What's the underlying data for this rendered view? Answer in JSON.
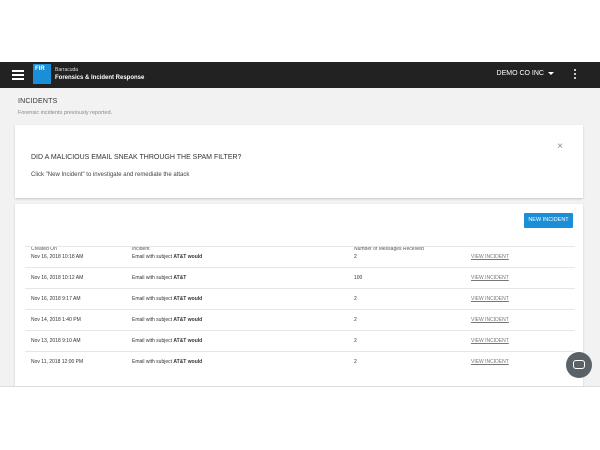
{
  "app": {
    "logo_text": "FIR",
    "brand_line1": "Barracuda",
    "brand_line2": "Forensics & Incident Response",
    "account": "DEMO CO INC"
  },
  "page": {
    "title": "INCIDENTS",
    "subtitle": "Forensic incidents previously reported."
  },
  "banner": {
    "heading": "DID A MALICIOUS EMAIL SNEAK THROUGH THE SPAM FILTER?",
    "message": "Click \"New Incident\" to investigate and remediate the attack",
    "close": "×"
  },
  "table": {
    "new_button": "NEW INCIDENT",
    "headers": {
      "created": "Created On",
      "incident": "Incident",
      "messages": "Number of Messages Received"
    },
    "subject_prefix": "Email with subject",
    "view_label": "VIEW INCIDENT",
    "rows": [
      {
        "created": "Nov 16, 2018 10:18 AM",
        "subject": "AT&T would",
        "count": "2"
      },
      {
        "created": "Nov 16, 2018 10:12 AM",
        "subject": "AT&T",
        "count": "100"
      },
      {
        "created": "Nov 16, 2018 9:17 AM",
        "subject": "AT&T would",
        "count": "2"
      },
      {
        "created": "Nov 14, 2018 1:40 PM",
        "subject": "AT&T would",
        "count": "2"
      },
      {
        "created": "Nov 13, 2018 9:10 AM",
        "subject": "AT&T would",
        "count": "2"
      },
      {
        "created": "Nov 11, 2018 12:00 PM",
        "subject": "AT&T would",
        "count": "2"
      }
    ]
  },
  "icons": {
    "menu": "hamburger-icon",
    "more": "kebab-icon",
    "close": "close-icon",
    "chat": "chat-icon",
    "dropdown": "caret-down-icon"
  },
  "colors": {
    "appbar": "#222222",
    "accent": "#1a8ed6",
    "background": "#f2f2f2"
  }
}
